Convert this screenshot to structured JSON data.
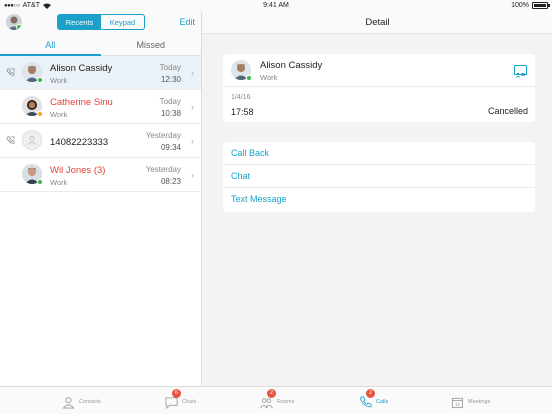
{
  "status_bar": {
    "carrier": "AT&T",
    "time": "9:41 AM",
    "battery": "100%",
    "battery_level": 1.0
  },
  "left": {
    "segments": [
      "Recents",
      "Keypad"
    ],
    "active_segment": 0,
    "edit_label": "Edit",
    "subtabs": [
      "All",
      "Missed"
    ],
    "active_subtab": 0,
    "calls": [
      {
        "name": "Alison Cassidy",
        "sub": "Work",
        "day": "Today",
        "time": "12:30",
        "missed": false,
        "presence": "available",
        "avatar": "photo"
      },
      {
        "name": "Catherine Sinu",
        "sub": "Work",
        "day": "Today",
        "time": "10:38",
        "missed": true,
        "presence": "away",
        "avatar": "photo"
      },
      {
        "name": "14082223333",
        "sub": "",
        "day": "Yesterday",
        "time": "09:34",
        "missed": false,
        "presence": "",
        "avatar": "person-placeholder-icon"
      },
      {
        "name": "Wil Jones (3)",
        "sub": "Work",
        "day": "Yesterday",
        "time": "08:23",
        "missed": true,
        "presence": "available",
        "avatar": "photo"
      }
    ]
  },
  "right": {
    "title": "Detail",
    "contact": {
      "name": "Alison Cassidy",
      "sub": "Work",
      "date": "1/4/16",
      "time": "17:58",
      "status": "Cancelled"
    },
    "actions": [
      "Call Back",
      "Chat",
      "Text Message"
    ]
  },
  "tabbar": {
    "tabs": [
      {
        "label": "Contacts",
        "badge": "",
        "icon": "contacts-icon"
      },
      {
        "label": "Chats",
        "badge": "6",
        "icon": "chat-icon"
      },
      {
        "label": "Rooms",
        "badge": "2",
        "icon": "rooms-icon"
      },
      {
        "label": "Calls",
        "badge": "2",
        "icon": "phone-icon"
      },
      {
        "label": "Meetings",
        "badge": "",
        "icon": "calendar-icon"
      }
    ],
    "active_tab": 3
  },
  "colors": {
    "accent": "#1aa0c9",
    "missed": "#e0433f",
    "available": "#3cb54a",
    "away": "#f5a623",
    "badge": "#e7533f"
  }
}
